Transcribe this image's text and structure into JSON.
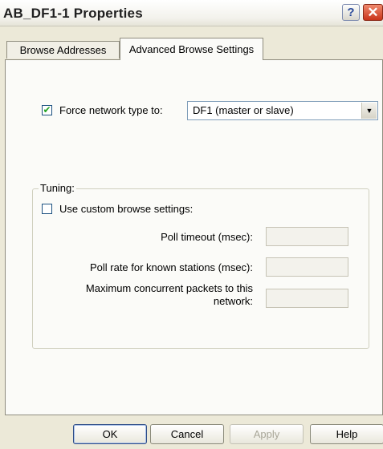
{
  "window": {
    "title": "AB_DF1-1 Properties",
    "help_glyph": "?",
    "close_glyph": "✕"
  },
  "tabs": [
    {
      "label": "Browse Addresses",
      "active": false
    },
    {
      "label": "Advanced Browse Settings",
      "active": true
    }
  ],
  "force_network": {
    "checked": true,
    "label": "Force network type to:",
    "selected": "DF1 (master or slave)"
  },
  "tuning": {
    "group_title": "Tuning:",
    "custom_label": "Use custom browse settings:",
    "custom_checked": false,
    "poll_timeout_label": "Poll timeout (msec):",
    "poll_rate_label": "Poll rate for known stations (msec):",
    "max_packets_label_line1": "Maximum concurrent packets to this",
    "max_packets_label_line2": "network:",
    "poll_timeout_value": "",
    "poll_rate_value": "",
    "max_packets_value": ""
  },
  "buttons": {
    "ok": "OK",
    "cancel": "Cancel",
    "apply": "Apply",
    "help": "Help"
  },
  "colors": {
    "dialog_bg": "#ece9d8",
    "panel_bg": "#fbfbf8",
    "check_green": "#21a121",
    "close_red": "#c9341a"
  }
}
